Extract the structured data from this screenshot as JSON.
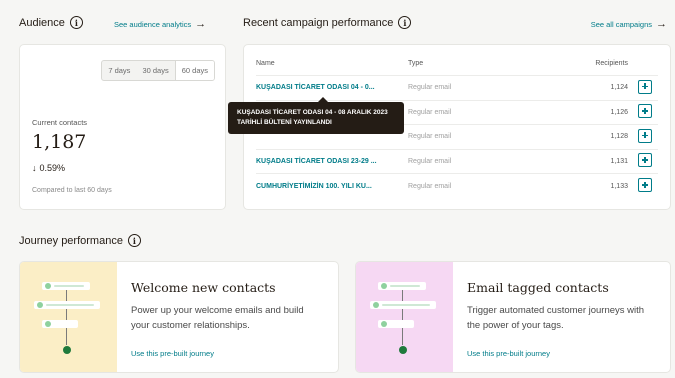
{
  "audience": {
    "title": "Audience",
    "analytics_link": "See audience analytics",
    "ranges": [
      "7 days",
      "30 days",
      "60 days"
    ],
    "active_range": "60 days",
    "contacts_label": "Current contacts",
    "contacts_value": "1,187",
    "change": "0.59%",
    "compare_text": "Compared to last 60 days"
  },
  "campaigns": {
    "title": "Recent campaign performance",
    "all_link": "See all campaigns",
    "columns": [
      "Name",
      "Type",
      "Recipients"
    ],
    "rows": [
      {
        "name": "KUŞADASI TİCARET ODASI 04 - 0...",
        "type": "Regular email",
        "recipients": "1,124"
      },
      {
        "name": "",
        "type": "Regular email",
        "recipients": "1,126"
      },
      {
        "name": "",
        "type": "Regular email",
        "recipients": "1,128"
      },
      {
        "name": "KUŞADASI TİCARET ODASI 23-29 ...",
        "type": "Regular email",
        "recipients": "1,131"
      },
      {
        "name": "CUMHURİYETİMİZİN 100. YILI KU...",
        "type": "Regular email",
        "recipients": "1,133"
      }
    ],
    "tooltip": "KUŞADASI TİCARET ODASI 04 - 08 ARALIK 2023 TARİHLİ BÜLTENİ YAYINLANDI"
  },
  "journeys": {
    "title": "Journey performance",
    "cards": [
      {
        "title": "Welcome new contacts",
        "description": "Power up your welcome emails and build your customer relationships.",
        "link": "Use this pre-built journey"
      },
      {
        "title": "Email tagged contacts",
        "description": "Trigger automated customer journeys with the power of your tags.",
        "link": "Use this pre-built journey"
      }
    ]
  },
  "icons": {
    "info": "info-icon",
    "arrow": "arrow-right-icon",
    "report": "view-report-icon",
    "down": "arrow-down-icon"
  },
  "colors": {
    "link": "#007c89",
    "welcome_art": "#fbeec6",
    "tagged_art": "#f6d8f3",
    "dark": "#241c15"
  }
}
